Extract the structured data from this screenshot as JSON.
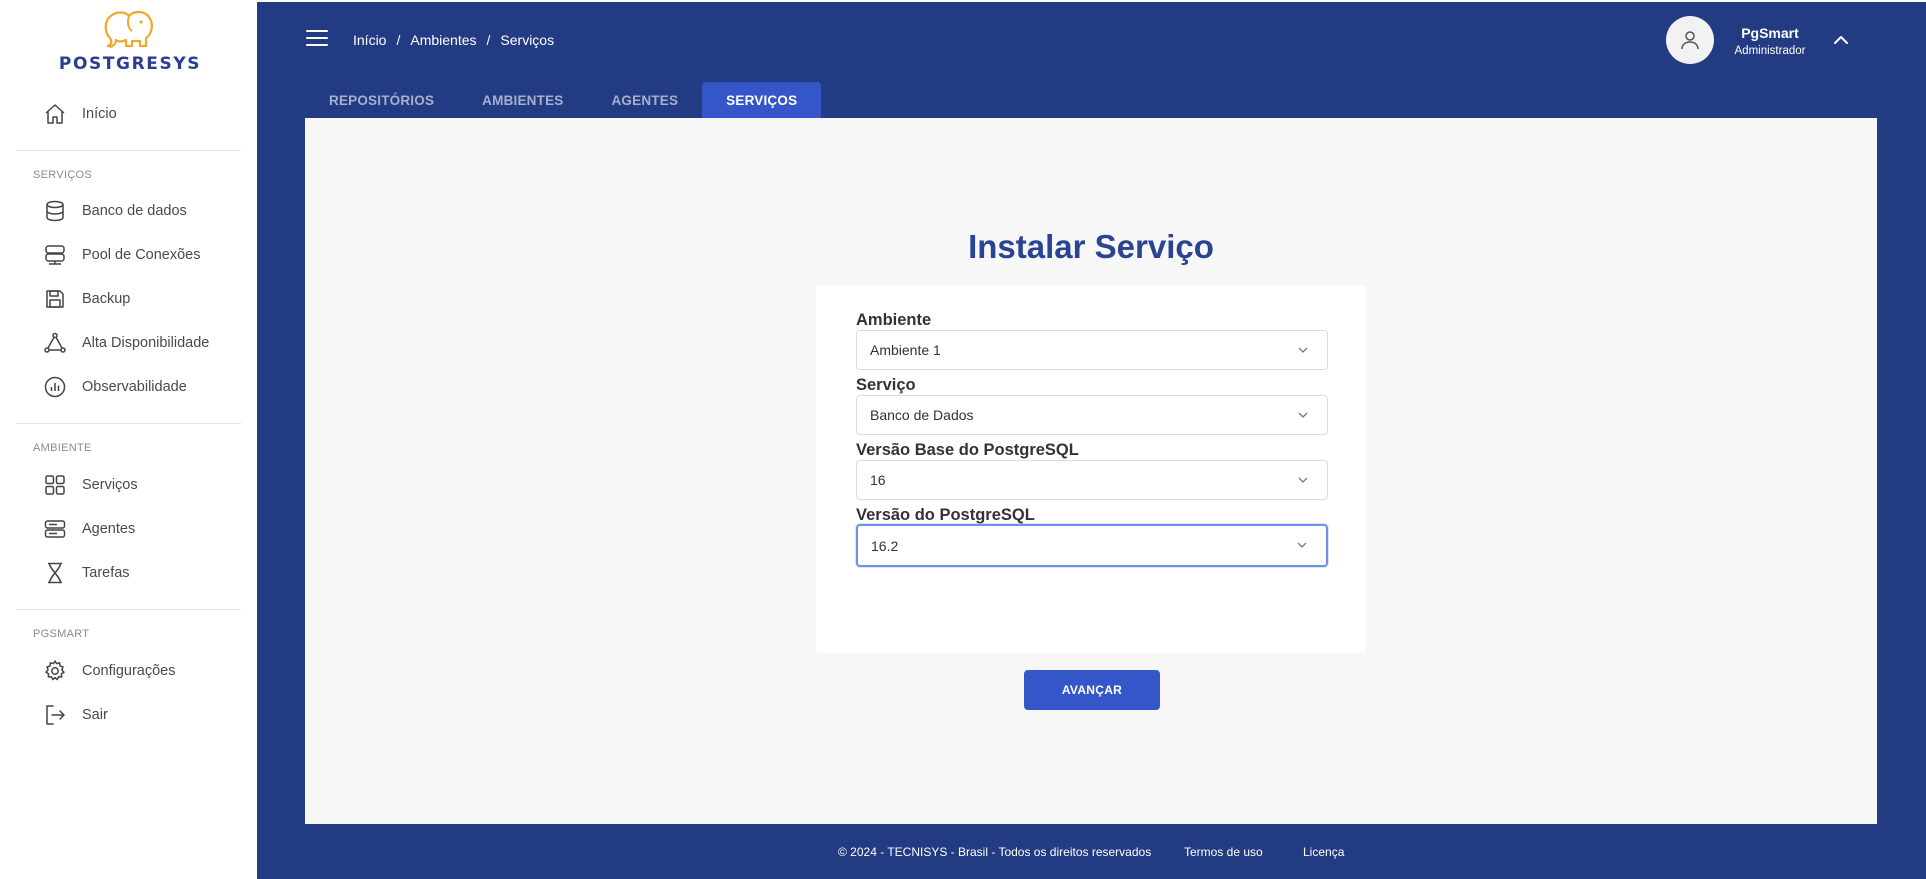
{
  "brand": {
    "name": "POSTGRESYS"
  },
  "sidebar": {
    "home": {
      "label": "Início"
    },
    "sections": [
      {
        "label": "SERVIÇOS",
        "items": [
          {
            "label": "Banco de dados",
            "icon": "database-icon"
          },
          {
            "label": "Pool de Conexões",
            "icon": "server-stack-icon"
          },
          {
            "label": "Backup",
            "icon": "save-icon"
          },
          {
            "label": "Alta Disponibilidade",
            "icon": "network-icon"
          },
          {
            "label": "Observabilidade",
            "icon": "chart-icon"
          }
        ]
      },
      {
        "label": "AMBIENTE",
        "items": [
          {
            "label": "Serviços",
            "icon": "grid-icon"
          },
          {
            "label": "Agentes",
            "icon": "server-icon"
          },
          {
            "label": "Tarefas",
            "icon": "hourglass-icon"
          }
        ]
      },
      {
        "label": "PGSMART",
        "items": [
          {
            "label": "Configurações",
            "icon": "gear-icon"
          },
          {
            "label": "Sair",
            "icon": "logout-icon"
          }
        ]
      }
    ]
  },
  "header": {
    "breadcrumb": [
      "Início",
      "Ambientes",
      "Serviços"
    ],
    "separator": "/",
    "user": {
      "name": "PgSmart",
      "role": "Administrador"
    }
  },
  "tabs": [
    {
      "label": "REPOSITÓRIOS",
      "active": false
    },
    {
      "label": "AMBIENTES",
      "active": false
    },
    {
      "label": "AGENTES",
      "active": false
    },
    {
      "label": "SERVIÇOS",
      "active": true
    }
  ],
  "form": {
    "title": "Instalar Serviço",
    "fields": [
      {
        "label": "Ambiente",
        "value": "Ambiente 1"
      },
      {
        "label": "Serviço",
        "value": "Banco de Dados"
      },
      {
        "label": "Versão Base do PostgreSQL",
        "value": "16"
      },
      {
        "label": "Versão do PostgreSQL",
        "value": "16.2"
      }
    ],
    "submit_label": "AVANÇAR"
  },
  "footer": {
    "copyright": "© 2024 - TECNISYS - Brasil - Todos os direitos reservados",
    "terms": "Termos de uso",
    "license": "Licença"
  },
  "colors": {
    "primary": "#233b82",
    "accent": "#3556c9",
    "title": "#2a4493",
    "logo_elephant": "#f4a62a"
  }
}
